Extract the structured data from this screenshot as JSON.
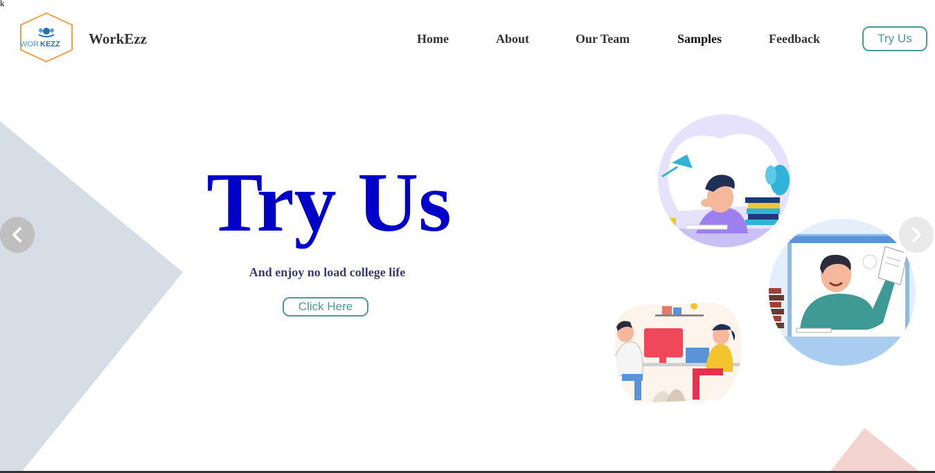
{
  "stray_text": "k",
  "header": {
    "logo_text_light": "WOR",
    "logo_text_bold": "KEZZ",
    "brand_name": "WorkEzz",
    "nav": [
      {
        "label": "Home"
      },
      {
        "label": "About"
      },
      {
        "label": "Our Team"
      },
      {
        "label": "Samples"
      },
      {
        "label": "Feedback"
      }
    ],
    "try_button_label": "Try Us"
  },
  "hero": {
    "title": "Try Us",
    "subtitle": "And enjoy no load college life",
    "cta_label": "Click Here"
  },
  "carousel": {
    "prev_icon": "chevron-left-icon",
    "next_icon": "chevron-right-icon"
  },
  "colors": {
    "title": "#0000c8",
    "accent": "#4a9a9a",
    "triangle_gray": "#d6dde5",
    "triangle_pink": "#f3d3d0"
  }
}
